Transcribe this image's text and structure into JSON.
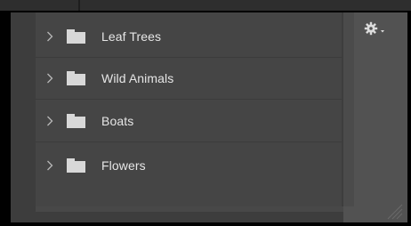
{
  "folders": [
    {
      "label": "Leaf Trees",
      "expanded": false
    },
    {
      "label": "Wild Animals",
      "expanded": false
    },
    {
      "label": "Boats",
      "expanded": false
    },
    {
      "label": "Flowers",
      "expanded": false
    }
  ],
  "icons": {
    "expand": "chevron-right-icon",
    "folder": "folder-icon",
    "settings": "gear-icon",
    "settings_menu": "dropdown-caret-icon",
    "resize": "resize-grip-icon"
  },
  "colors": {
    "panel": "#3d3d3d",
    "list_background": "#454545",
    "text": "#e6e6e6",
    "icon": "#d8d8d8"
  }
}
